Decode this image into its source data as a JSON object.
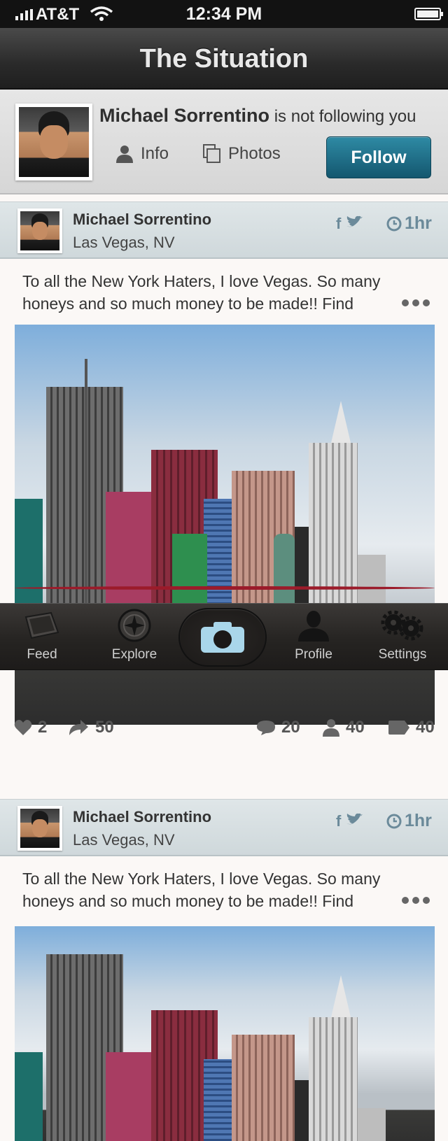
{
  "status_bar": {
    "carrier": "AT&T",
    "time": "12:34 PM"
  },
  "nav": {
    "title": "The Situation"
  },
  "profile": {
    "name": "Michael Sorrentino",
    "follow_status": "is not following you",
    "tabs": {
      "info": "Info",
      "photos": "Photos"
    },
    "follow_label": "Follow"
  },
  "posts": [
    {
      "author": "Michael Sorrentino",
      "location": "Las Vegas, NV",
      "time": "1hr",
      "text": "To all the New York Haters, I love Vegas. So many honeys and so much money to be made!! Find",
      "likes": "2",
      "reposts": "50",
      "comments": "20",
      "people": "40",
      "tags": "40"
    },
    {
      "author": "Michael Sorrentino",
      "location": "Las Vegas, NV",
      "time": "1hr",
      "text": "To all the New York Haters, I love Vegas. So many honeys and so much money to be made!! Find"
    }
  ],
  "tabbar": {
    "feed": "Feed",
    "explore": "Explore",
    "profile": "Profile",
    "settings": "Settings"
  },
  "colors": {
    "accent": "#1f7590",
    "link_gray": "#6b8a9a"
  }
}
